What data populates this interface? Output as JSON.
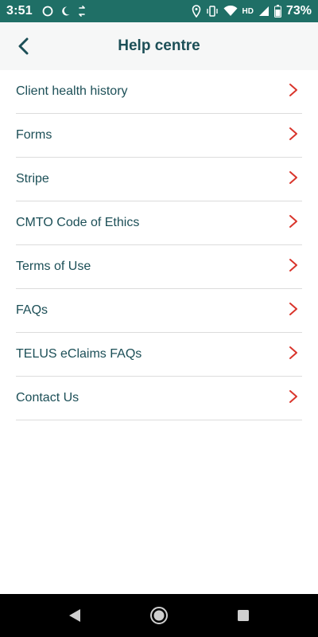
{
  "status_bar": {
    "time": "3:51",
    "network": "HD",
    "battery": "73%",
    "left_icons": [
      "circle-icon",
      "moon-icon",
      "sync-icon"
    ],
    "right_icons": [
      "location-icon",
      "vibrate-icon",
      "wifi-icon",
      "signal-icon",
      "battery-icon"
    ]
  },
  "header": {
    "title": "Help centre",
    "back_icon": "back-chevron-icon"
  },
  "menu": {
    "items": [
      {
        "label": "Client health history"
      },
      {
        "label": "Forms"
      },
      {
        "label": "Stripe"
      },
      {
        "label": "CMTO Code of Ethics"
      },
      {
        "label": "Terms of Use"
      },
      {
        "label": "FAQs"
      },
      {
        "label": "TELUS eClaims FAQs"
      },
      {
        "label": "Contact Us"
      }
    ]
  },
  "nav_bar": {
    "buttons": [
      "back-triangle-icon",
      "home-circle-icon",
      "recents-square-icon"
    ]
  },
  "colors": {
    "status_bar": "#1f6f66",
    "header_bg": "#f6f7f7",
    "title_text": "#1c4f57",
    "chevron_red": "#d9342b",
    "divider": "#dcdcdc"
  }
}
